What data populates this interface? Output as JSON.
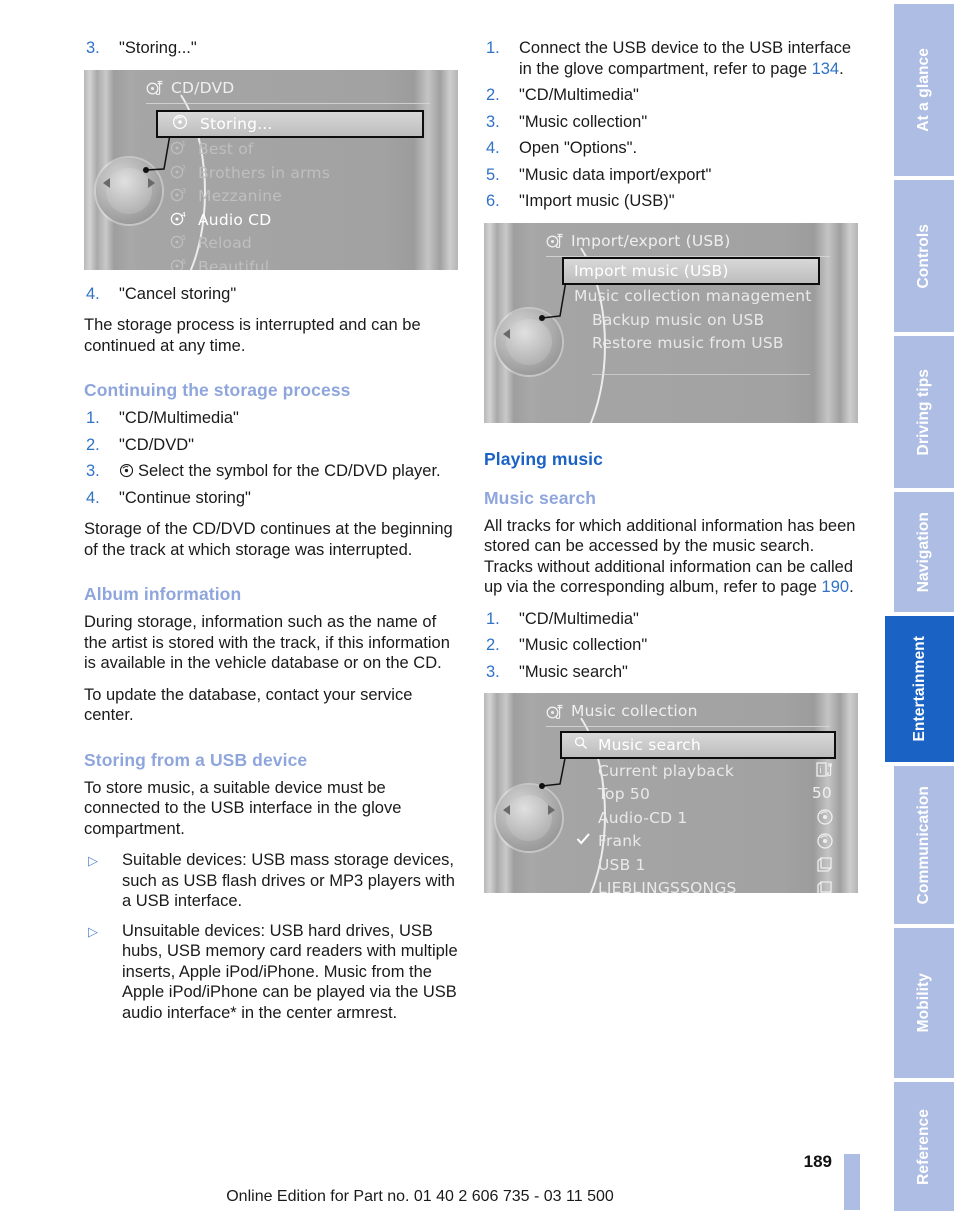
{
  "document": {
    "page_number": "189",
    "footer_note": "Online Edition for Part no. 01 40 2 606 735 - 03 11 500"
  },
  "side_tabs": [
    {
      "label": "At a glance",
      "active": false
    },
    {
      "label": "Controls",
      "active": false
    },
    {
      "label": "Driving tips",
      "active": false
    },
    {
      "label": "Navigation",
      "active": false
    },
    {
      "label": "Entertainment",
      "active": true
    },
    {
      "label": "Communication",
      "active": false
    },
    {
      "label": "Mobility",
      "active": false
    },
    {
      "label": "Reference",
      "active": false
    }
  ],
  "colors": {
    "heading_major": "#1a62c4",
    "heading_minor": "#8fa6dd",
    "list_number": "#2f72c6",
    "page_ref": "#2f72c6",
    "tab_inactive": "#aebde4",
    "tab_active": "#1a62c4"
  },
  "left_column": {
    "step3": {
      "num": "3.",
      "text": "\"Storing...\""
    },
    "screenshot_cddvd": {
      "title": "CD/DVD",
      "title_icon": "cd-note-icon",
      "rows": [
        {
          "label": "Storing...",
          "icon": "cd-icon",
          "state": "selected"
        },
        {
          "label": "Best of",
          "icon": "cd-1-icon",
          "state": "dim"
        },
        {
          "label": "Brothers in arms",
          "icon": "cd-2-icon",
          "state": "dim"
        },
        {
          "label": "Mezzanine",
          "icon": "cd-3-icon",
          "state": "dim"
        },
        {
          "label": "Audio CD",
          "icon": "cd-4-icon",
          "state": "bright"
        },
        {
          "label": "Reload",
          "icon": "cd-5-icon",
          "state": "dim"
        },
        {
          "label": "Beautiful",
          "icon": "cd-6-icon",
          "state": "dim"
        }
      ]
    },
    "step4": {
      "num": "4.",
      "text": "\"Cancel storing\""
    },
    "para_interrupted": "The storage process is interrupted and can be continued at any time.",
    "heading_continuing": "Continuing the storage process",
    "continuing_steps": [
      {
        "num": "1.",
        "text": "\"CD/Multimedia\"",
        "icon": null
      },
      {
        "num": "2.",
        "text": "\"CD/DVD\"",
        "icon": null
      },
      {
        "num": "3.",
        "text": "Select the symbol for the CD/DVD player.",
        "icon": "cd-icon"
      },
      {
        "num": "4.",
        "text": "\"Continue storing\"",
        "icon": null
      }
    ],
    "para_continues": "Storage of the CD/DVD continues at the beginning of the track at which storage was interrupted.",
    "heading_album_info": "Album information",
    "para_album_1": "During storage, information such as the name of the artist is stored with the track, if this information is available in the vehicle database or on the CD.",
    "para_album_2": "To update the database, contact your service center.",
    "heading_usb": "Storing from a USB device",
    "para_usb": "To store music, a suitable device must be connected to the USB interface in the glove compartment.",
    "bullets": [
      "Suitable devices: USB mass storage devices, such as USB flash drives or MP3 players with a USB interface.",
      "Unsuitable devices: USB hard drives, USB hubs, USB memory card readers with multiple inserts, Apple iPod/iPhone. Music from the Apple iPod/iPhone can be played via the USB audio interface* in the center armrest."
    ]
  },
  "right_column": {
    "usb_steps": [
      {
        "num": "1.",
        "text_before": "Connect the USB device to the USB interface in the glove compartment, refer to page ",
        "page_ref": "134",
        "text_after": "."
      },
      {
        "num": "2.",
        "text_before": "\"CD/Multimedia\"",
        "page_ref": "",
        "text_after": ""
      },
      {
        "num": "3.",
        "text_before": "\"Music collection\"",
        "page_ref": "",
        "text_after": ""
      },
      {
        "num": "4.",
        "text_before": "Open \"Options\".",
        "page_ref": "",
        "text_after": ""
      },
      {
        "num": "5.",
        "text_before": "\"Music data import/export\"",
        "page_ref": "",
        "text_after": ""
      },
      {
        "num": "6.",
        "text_before": "\"Import music (USB)\"",
        "page_ref": "",
        "text_after": ""
      }
    ],
    "screenshot_importexport": {
      "title": "Import/export (USB)",
      "title_icon": "cd-note-icon",
      "rows": [
        {
          "label": "Import music (USB)",
          "state": "selected"
        },
        {
          "label": "Music collection management",
          "state": "normal"
        },
        {
          "label": "Backup music on USB",
          "state": "indent"
        },
        {
          "label": "Restore music from USB",
          "state": "indent"
        }
      ]
    },
    "heading_playing_music": "Playing music",
    "heading_music_search": "Music search",
    "para_music_search_before": "All tracks for which additional information has been stored can be accessed by the music search. Tracks without additional information can be called up via the corresponding album, refer to page ",
    "para_music_search_ref": "190",
    "para_music_search_after": ".",
    "music_search_steps": [
      {
        "num": "1.",
        "text": "\"CD/Multimedia\""
      },
      {
        "num": "2.",
        "text": "\"Music collection\""
      },
      {
        "num": "3.",
        "text": "\"Music search\""
      }
    ],
    "screenshot_music_collection": {
      "title": "Music collection",
      "title_icon": "cd-note-icon",
      "rows": [
        {
          "label": "Music search",
          "left_icon": "magnifier-icon",
          "right_icon": "",
          "state": "selected"
        },
        {
          "label": "Current playback",
          "left_icon": "",
          "right_icon": "info-note-icon",
          "state": "normal"
        },
        {
          "label": "Top 50",
          "left_icon": "",
          "right_icon": "50",
          "state": "normal"
        },
        {
          "label": "Audio-CD 1",
          "left_icon": "",
          "right_icon": "cd-icon",
          "state": "normal"
        },
        {
          "label": "Frank",
          "left_icon": "check-icon",
          "right_icon": "cd-icon",
          "state": "normal"
        },
        {
          "label": "USB 1",
          "left_icon": "",
          "right_icon": "folder-icon",
          "state": "normal"
        },
        {
          "label": "LIEBLINGSSONGS",
          "left_icon": "",
          "right_icon": "folder-icon",
          "state": "normal"
        }
      ]
    }
  }
}
